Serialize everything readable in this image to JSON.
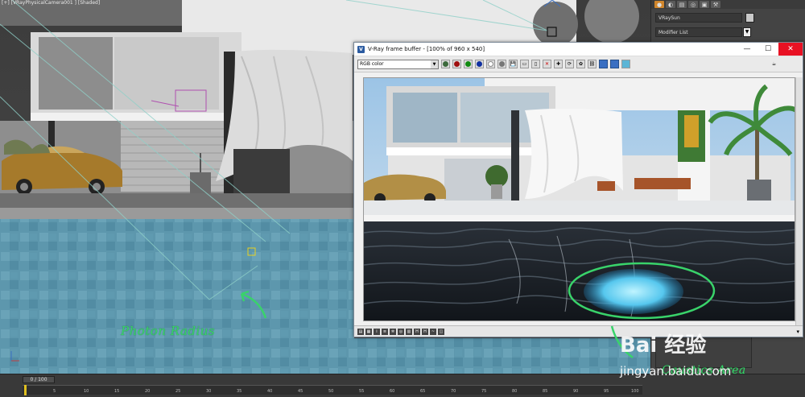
{
  "viewport": {
    "label": "[+] [VRayPhysicalCamera001 ] [Shaded]",
    "annotation_photon": "Photon Radius",
    "annotation_caustics": "Caustics Area"
  },
  "command_panel": {
    "object_name": "VRaySun",
    "modifier_list": "Modifier List",
    "dropdown_arrow": "▼"
  },
  "vfb": {
    "title": "V-Ray frame buffer - [100% of 960 x 540]",
    "channel": "RGB color",
    "minimize": "—",
    "maximize": "☐",
    "close": "✕"
  },
  "timeline": {
    "frame_slider": "0 / 100",
    "ticks": [
      "0",
      "5",
      "10",
      "15",
      "20",
      "25",
      "30",
      "35",
      "40",
      "45",
      "50",
      "55",
      "60",
      "65",
      "70",
      "75",
      "80",
      "85",
      "90",
      "95",
      "100"
    ]
  },
  "watermark": {
    "line1": "Bai 经验",
    "line2": "jingyan.baidu.com"
  },
  "colors": {
    "annotation": "#39d36a",
    "close_button": "#e81123",
    "timeline_marker": "#e0c020"
  }
}
